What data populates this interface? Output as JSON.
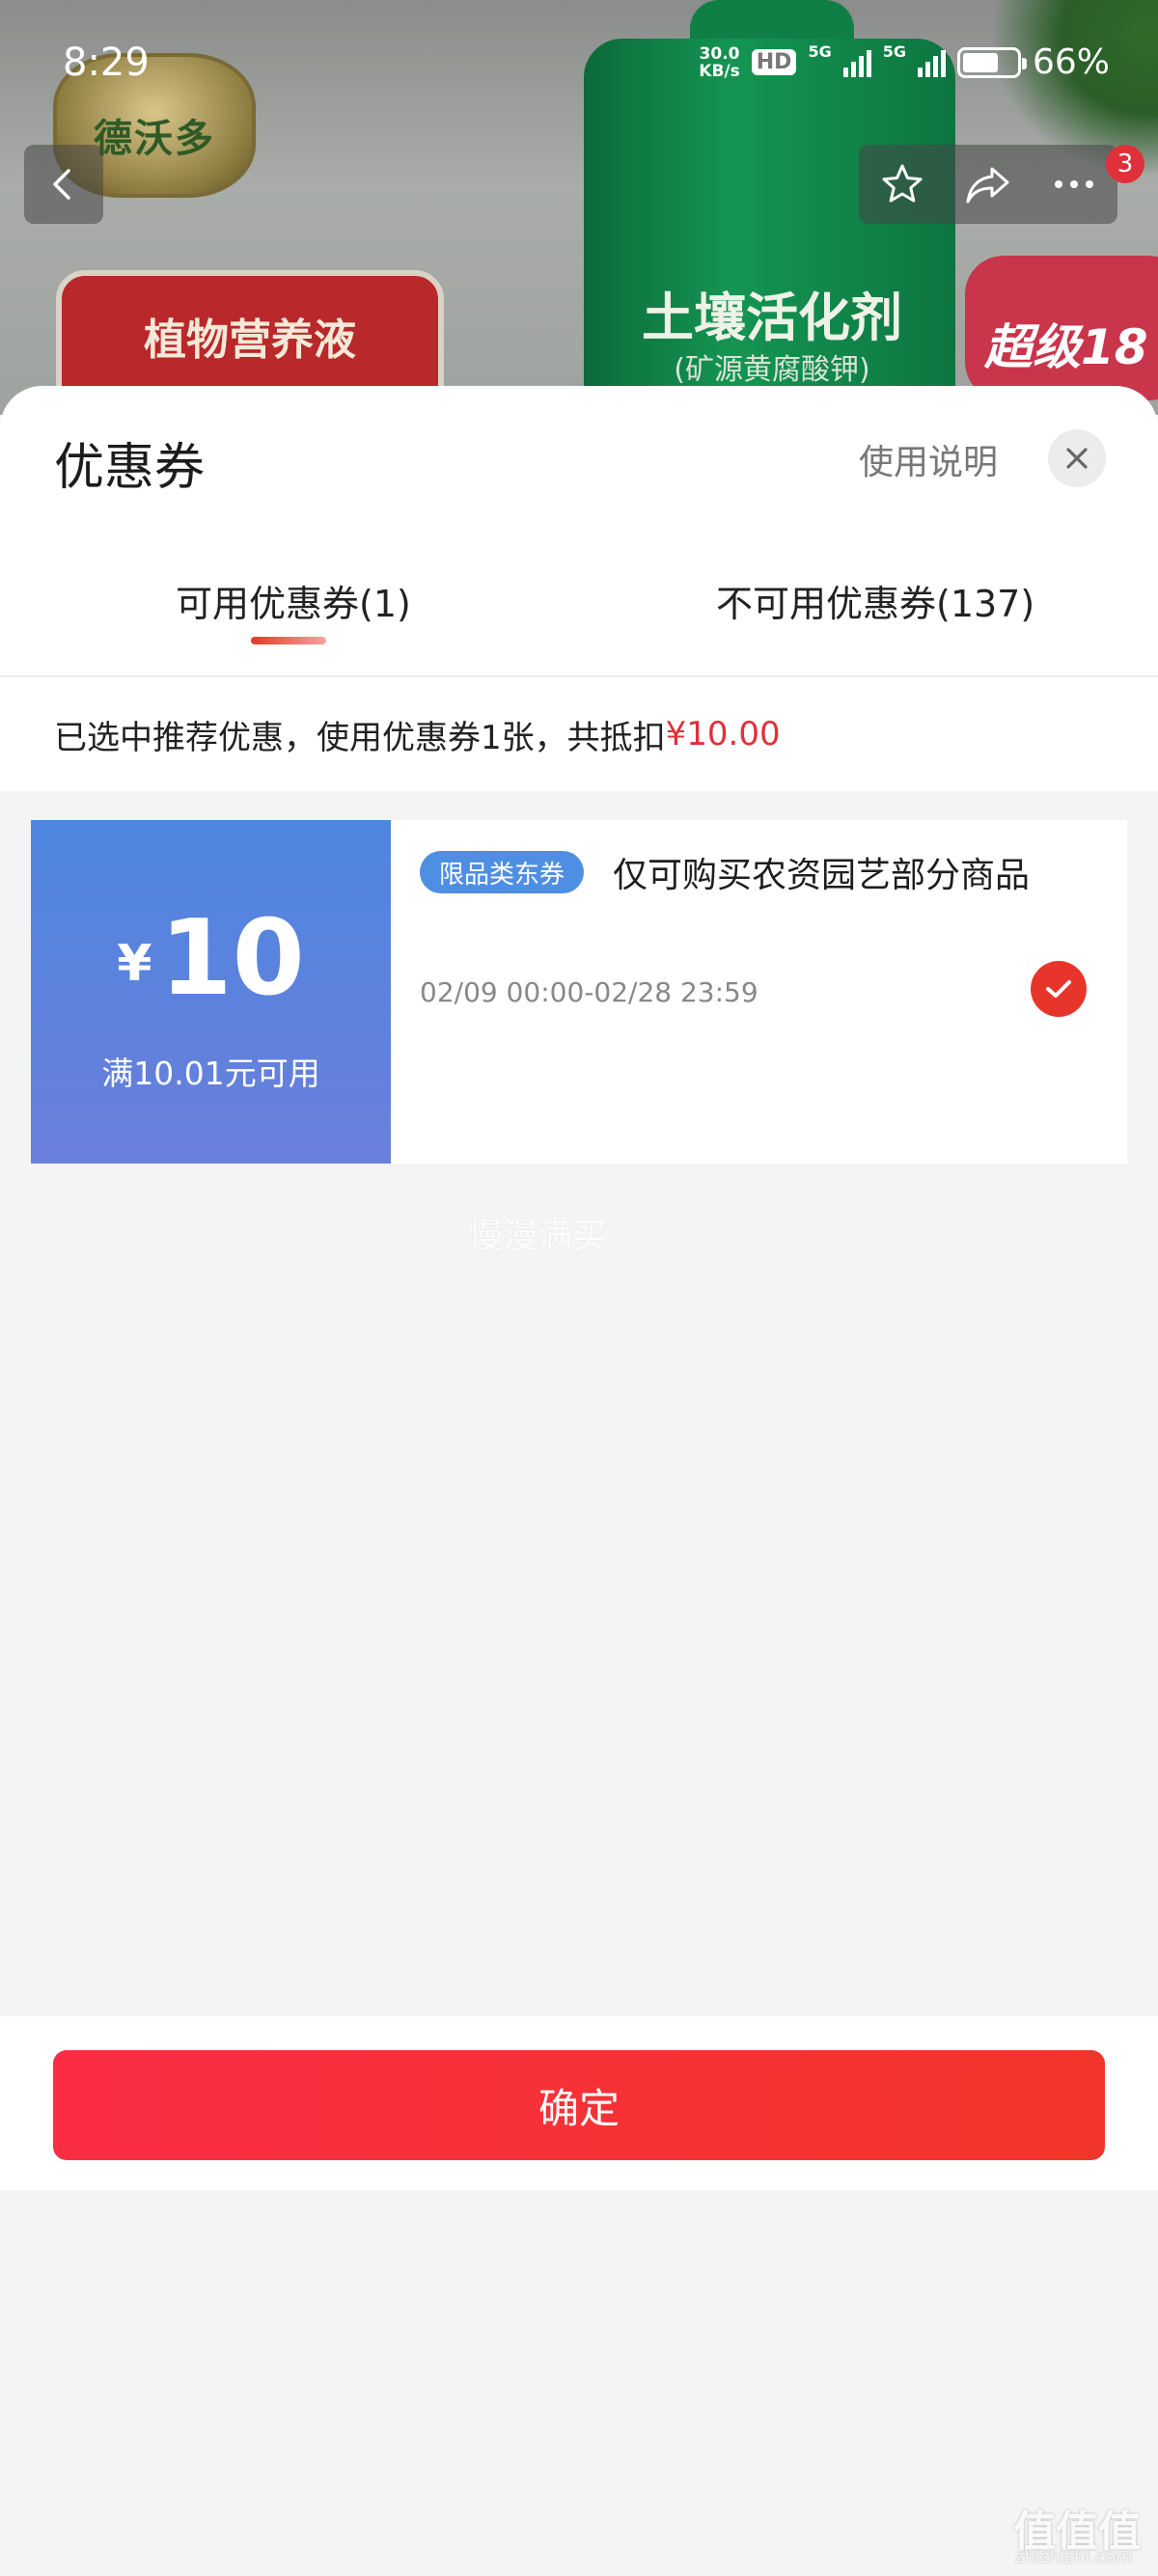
{
  "status_bar": {
    "time": "8:29",
    "net_speed_value": "30.0",
    "net_speed_unit": "KB/s",
    "hd_label": "HD",
    "network_1": "5G",
    "network_2": "5G",
    "battery_percent": "66%",
    "battery_level": 0.66
  },
  "background": {
    "brand_logo_text": "德沃多",
    "box_text": "植物营养液",
    "bottle_title": "土壤活化剂",
    "bottle_subtitle": "(矿源黄腐酸钾)",
    "promo_badge": "超级18"
  },
  "nav": {
    "icons": [
      "back-icon",
      "star-icon",
      "share-icon",
      "more-icon"
    ],
    "message_badge": "3"
  },
  "sheet": {
    "title": "优惠券",
    "usage_link": "使用说明",
    "close_icon": "close-icon",
    "tabs": [
      {
        "label": "可用优惠券(1)",
        "active": true
      },
      {
        "label": "不可用优惠券(137)",
        "active": false
      }
    ],
    "summary_text": "已选中推荐优惠，使用优惠券1张，共抵扣",
    "summary_amount": "¥10.00"
  },
  "coupons": [
    {
      "currency": "¥",
      "amount": "10",
      "condition": "满10.01元可用",
      "tag": "限品类东券",
      "description": "仅可购买农资园艺部分商品",
      "validity": "02/09 00:00-02/28 23:59",
      "selected": true
    }
  ],
  "watermark_mid": "慢漫满买",
  "footer": {
    "confirm_label": "确定"
  },
  "site_watermark": {
    "mark": "值值值",
    "url": "zhizhizhi.com"
  },
  "colors": {
    "accent_red": "#e0303a",
    "coupon_blue": "#4e86df",
    "confirm_red": "#fa2d44"
  }
}
